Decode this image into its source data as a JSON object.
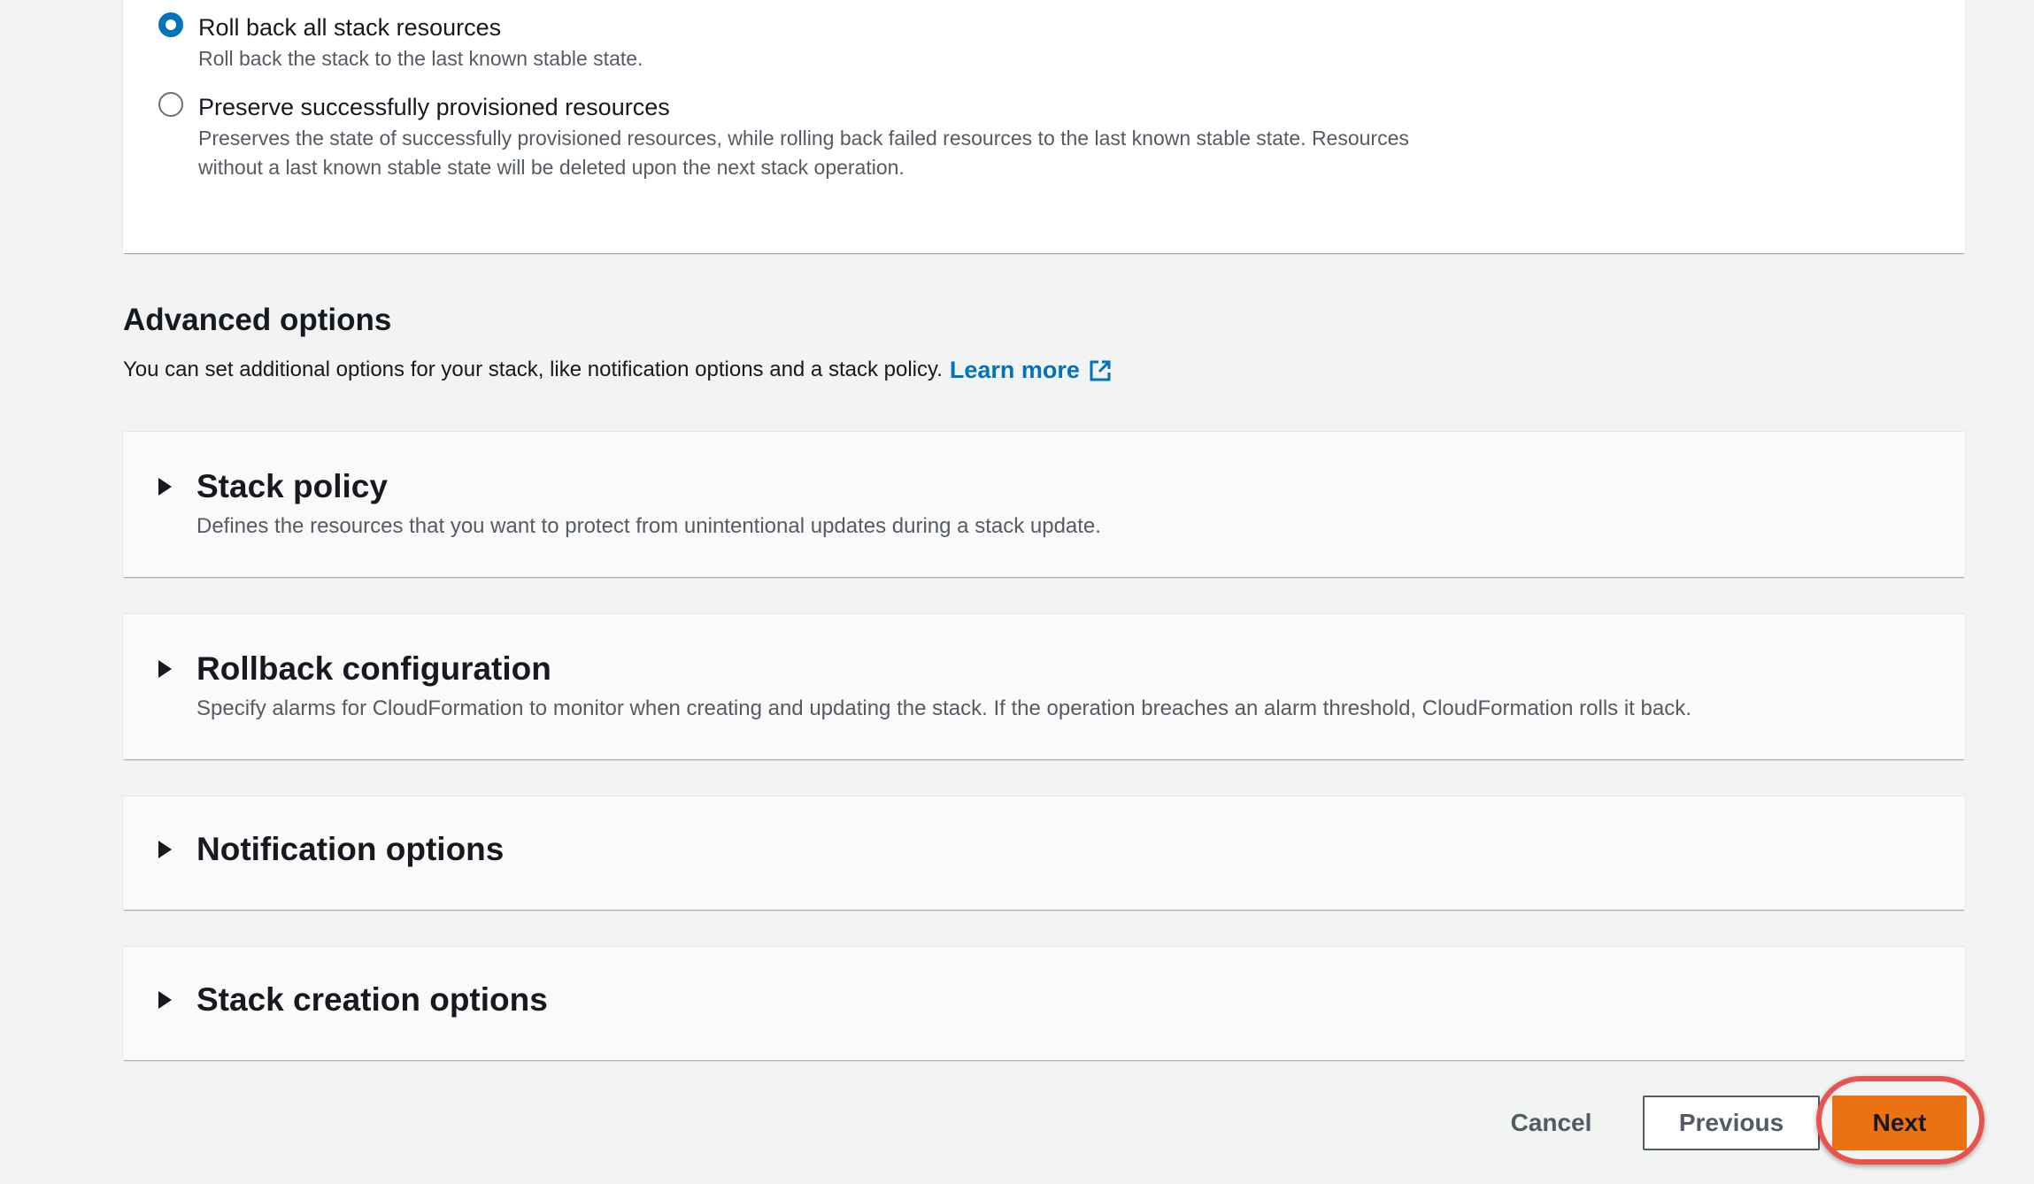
{
  "rollback": {
    "options": [
      {
        "label": "Roll back all stack resources",
        "description": "Roll back the stack to the last known stable state.",
        "selected": true
      },
      {
        "label": "Preserve successfully provisioned resources",
        "description_line1": "Preserves the state of successfully provisioned resources, while rolling back failed resources to the last known stable state. Resources",
        "description_line2": "without a last known stable state will be deleted upon the next stack operation.",
        "selected": false
      }
    ]
  },
  "advanced": {
    "title": "Advanced options",
    "description": "You can set additional options for your stack, like notification options and a stack policy.",
    "learn_more": "Learn more",
    "sections": [
      {
        "title": "Stack policy",
        "description": "Defines the resources that you want to protect from unintentional updates during a stack update."
      },
      {
        "title": "Rollback configuration",
        "description": "Specify alarms for CloudFormation to monitor when creating and updating the stack. If the operation breaches an alarm threshold, CloudFormation rolls it back."
      },
      {
        "title": "Notification options"
      },
      {
        "title": "Stack creation options"
      }
    ]
  },
  "footer": {
    "cancel": "Cancel",
    "previous": "Previous",
    "next": "Next"
  },
  "colors": {
    "primary_button": "#ec7211",
    "link": "#0073bb",
    "highlight": "#e8544d"
  }
}
